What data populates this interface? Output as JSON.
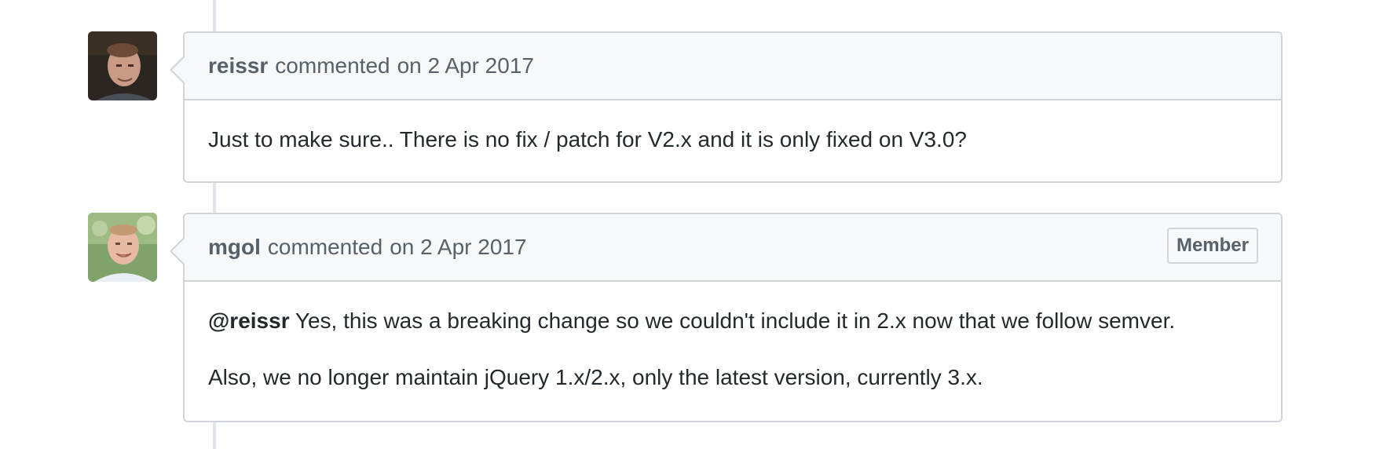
{
  "comments": [
    {
      "author": "reissr",
      "action": "commented",
      "timestamp": "on 2 Apr 2017",
      "avatar_icon": "user-avatar-dark",
      "body": [
        "Just to make sure.. There is no fix / patch for V2.x and it is only fixed on V3.0?"
      ]
    },
    {
      "author": "mgol",
      "action": "commented",
      "timestamp": "on 2 Apr 2017",
      "badge": "Member",
      "avatar_icon": "user-avatar-light",
      "mention": "@reissr",
      "body": [
        "Yes, this was a breaking change so we couldn't include it in 2.x now that we follow semver.",
        "Also, we no longer maintain jQuery 1.x/2.x, only the latest version, currently 3.x."
      ]
    }
  ],
  "colors": {
    "border": "#d1d5da",
    "header_bg": "#f6f8fa",
    "muted_text": "#586069",
    "text": "#24292e",
    "timeline": "#e1e4e8"
  }
}
